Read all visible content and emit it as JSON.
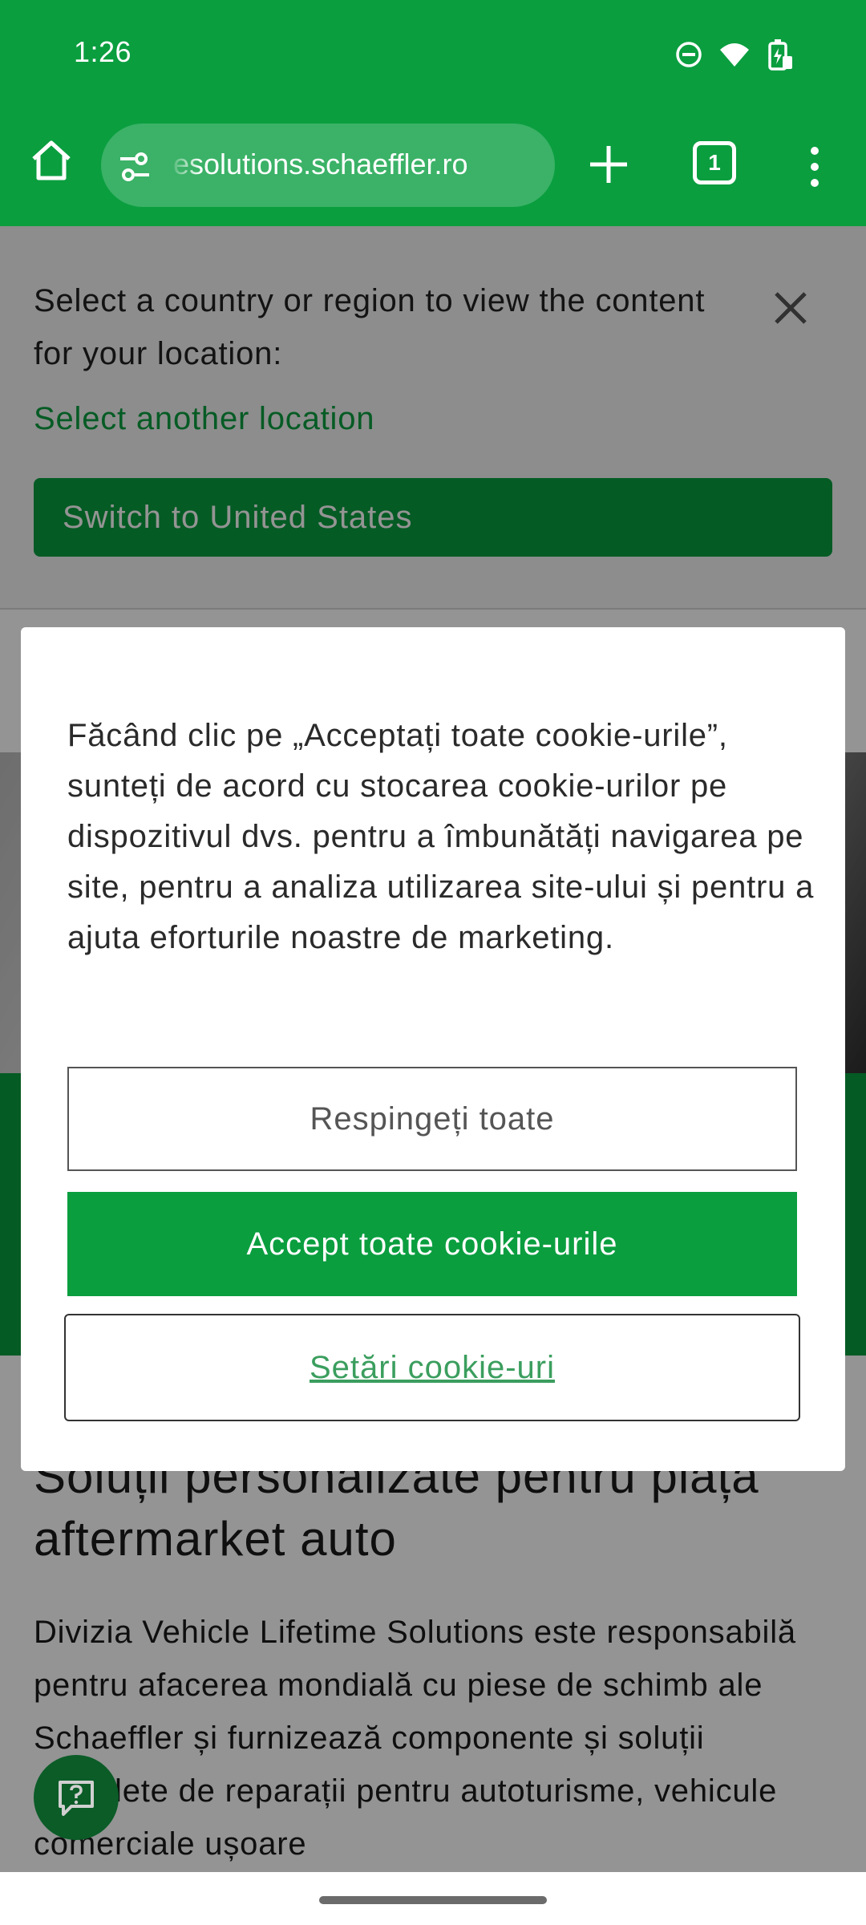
{
  "status_bar": {
    "time": "1:26",
    "icons": [
      "do-not-disturb-icon",
      "wifi-icon",
      "battery-charging-icon"
    ]
  },
  "toolbar": {
    "url": "esolutions.schaeffler.ro",
    "tab_count": "1",
    "icons": [
      "home-icon",
      "site-settings-icon",
      "new-tab-icon",
      "tab-switcher-icon",
      "more-menu-icon"
    ]
  },
  "location_banner": {
    "message": "Select a country or region to view the content for your location:",
    "link": "Select another location",
    "switch_button": "Switch to United States"
  },
  "page": {
    "heading": "Soluții personalizate pentru piața aftermarket auto",
    "body": "Divizia Vehicle Lifetime Solutions este responsabilă pentru afacerea mondială cu piese de schimb ale Schaeffler și furnizează componente și soluții complete de reparații pentru autoturisme, vehicule comerciale ușoare"
  },
  "cookie_dialog": {
    "text": "Făcând clic pe „Acceptați toate cookie-urile”, sunteți de acord cu stocarea cookie-urilor pe dispozitivul dvs. pentru a îmbunătăți navigarea pe site, pentru a analiza utilizarea site-ului și pentru a ajuta eforturile noastre de marketing.",
    "reject_label": "Respingeți toate",
    "accept_label": "Accept toate cookie-urile",
    "settings_label": "Setări cookie-uri"
  },
  "colors": {
    "brand_green": "#0a9e3f",
    "url_pill": "#3bb267",
    "chat_fab": "#0b5c27"
  }
}
